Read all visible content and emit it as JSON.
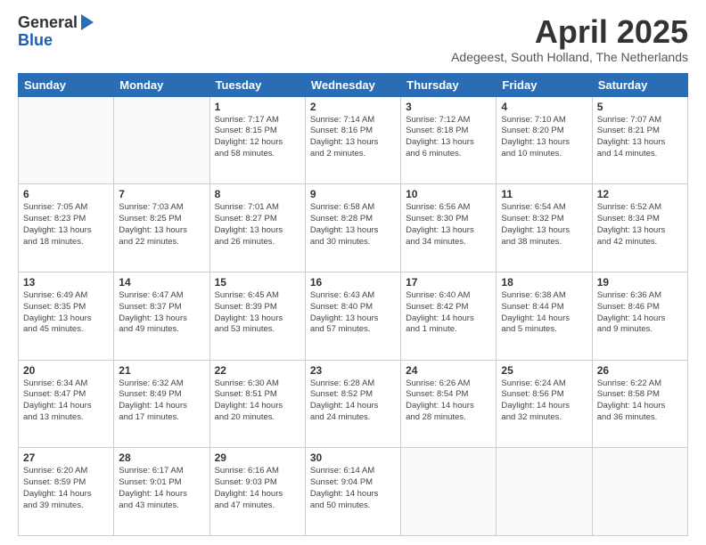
{
  "header": {
    "logo_general": "General",
    "logo_blue": "Blue",
    "month_title": "April 2025",
    "subtitle": "Adegeest, South Holland, The Netherlands"
  },
  "days_of_week": [
    "Sunday",
    "Monday",
    "Tuesday",
    "Wednesday",
    "Thursday",
    "Friday",
    "Saturday"
  ],
  "weeks": [
    [
      {
        "day": "",
        "info": ""
      },
      {
        "day": "",
        "info": ""
      },
      {
        "day": "1",
        "info": "Sunrise: 7:17 AM\nSunset: 8:15 PM\nDaylight: 12 hours\nand 58 minutes."
      },
      {
        "day": "2",
        "info": "Sunrise: 7:14 AM\nSunset: 8:16 PM\nDaylight: 13 hours\nand 2 minutes."
      },
      {
        "day": "3",
        "info": "Sunrise: 7:12 AM\nSunset: 8:18 PM\nDaylight: 13 hours\nand 6 minutes."
      },
      {
        "day": "4",
        "info": "Sunrise: 7:10 AM\nSunset: 8:20 PM\nDaylight: 13 hours\nand 10 minutes."
      },
      {
        "day": "5",
        "info": "Sunrise: 7:07 AM\nSunset: 8:21 PM\nDaylight: 13 hours\nand 14 minutes."
      }
    ],
    [
      {
        "day": "6",
        "info": "Sunrise: 7:05 AM\nSunset: 8:23 PM\nDaylight: 13 hours\nand 18 minutes."
      },
      {
        "day": "7",
        "info": "Sunrise: 7:03 AM\nSunset: 8:25 PM\nDaylight: 13 hours\nand 22 minutes."
      },
      {
        "day": "8",
        "info": "Sunrise: 7:01 AM\nSunset: 8:27 PM\nDaylight: 13 hours\nand 26 minutes."
      },
      {
        "day": "9",
        "info": "Sunrise: 6:58 AM\nSunset: 8:28 PM\nDaylight: 13 hours\nand 30 minutes."
      },
      {
        "day": "10",
        "info": "Sunrise: 6:56 AM\nSunset: 8:30 PM\nDaylight: 13 hours\nand 34 minutes."
      },
      {
        "day": "11",
        "info": "Sunrise: 6:54 AM\nSunset: 8:32 PM\nDaylight: 13 hours\nand 38 minutes."
      },
      {
        "day": "12",
        "info": "Sunrise: 6:52 AM\nSunset: 8:34 PM\nDaylight: 13 hours\nand 42 minutes."
      }
    ],
    [
      {
        "day": "13",
        "info": "Sunrise: 6:49 AM\nSunset: 8:35 PM\nDaylight: 13 hours\nand 45 minutes."
      },
      {
        "day": "14",
        "info": "Sunrise: 6:47 AM\nSunset: 8:37 PM\nDaylight: 13 hours\nand 49 minutes."
      },
      {
        "day": "15",
        "info": "Sunrise: 6:45 AM\nSunset: 8:39 PM\nDaylight: 13 hours\nand 53 minutes."
      },
      {
        "day": "16",
        "info": "Sunrise: 6:43 AM\nSunset: 8:40 PM\nDaylight: 13 hours\nand 57 minutes."
      },
      {
        "day": "17",
        "info": "Sunrise: 6:40 AM\nSunset: 8:42 PM\nDaylight: 14 hours\nand 1 minute."
      },
      {
        "day": "18",
        "info": "Sunrise: 6:38 AM\nSunset: 8:44 PM\nDaylight: 14 hours\nand 5 minutes."
      },
      {
        "day": "19",
        "info": "Sunrise: 6:36 AM\nSunset: 8:46 PM\nDaylight: 14 hours\nand 9 minutes."
      }
    ],
    [
      {
        "day": "20",
        "info": "Sunrise: 6:34 AM\nSunset: 8:47 PM\nDaylight: 14 hours\nand 13 minutes."
      },
      {
        "day": "21",
        "info": "Sunrise: 6:32 AM\nSunset: 8:49 PM\nDaylight: 14 hours\nand 17 minutes."
      },
      {
        "day": "22",
        "info": "Sunrise: 6:30 AM\nSunset: 8:51 PM\nDaylight: 14 hours\nand 20 minutes."
      },
      {
        "day": "23",
        "info": "Sunrise: 6:28 AM\nSunset: 8:52 PM\nDaylight: 14 hours\nand 24 minutes."
      },
      {
        "day": "24",
        "info": "Sunrise: 6:26 AM\nSunset: 8:54 PM\nDaylight: 14 hours\nand 28 minutes."
      },
      {
        "day": "25",
        "info": "Sunrise: 6:24 AM\nSunset: 8:56 PM\nDaylight: 14 hours\nand 32 minutes."
      },
      {
        "day": "26",
        "info": "Sunrise: 6:22 AM\nSunset: 8:58 PM\nDaylight: 14 hours\nand 36 minutes."
      }
    ],
    [
      {
        "day": "27",
        "info": "Sunrise: 6:20 AM\nSunset: 8:59 PM\nDaylight: 14 hours\nand 39 minutes."
      },
      {
        "day": "28",
        "info": "Sunrise: 6:17 AM\nSunset: 9:01 PM\nDaylight: 14 hours\nand 43 minutes."
      },
      {
        "day": "29",
        "info": "Sunrise: 6:16 AM\nSunset: 9:03 PM\nDaylight: 14 hours\nand 47 minutes."
      },
      {
        "day": "30",
        "info": "Sunrise: 6:14 AM\nSunset: 9:04 PM\nDaylight: 14 hours\nand 50 minutes."
      },
      {
        "day": "",
        "info": ""
      },
      {
        "day": "",
        "info": ""
      },
      {
        "day": "",
        "info": ""
      }
    ]
  ]
}
